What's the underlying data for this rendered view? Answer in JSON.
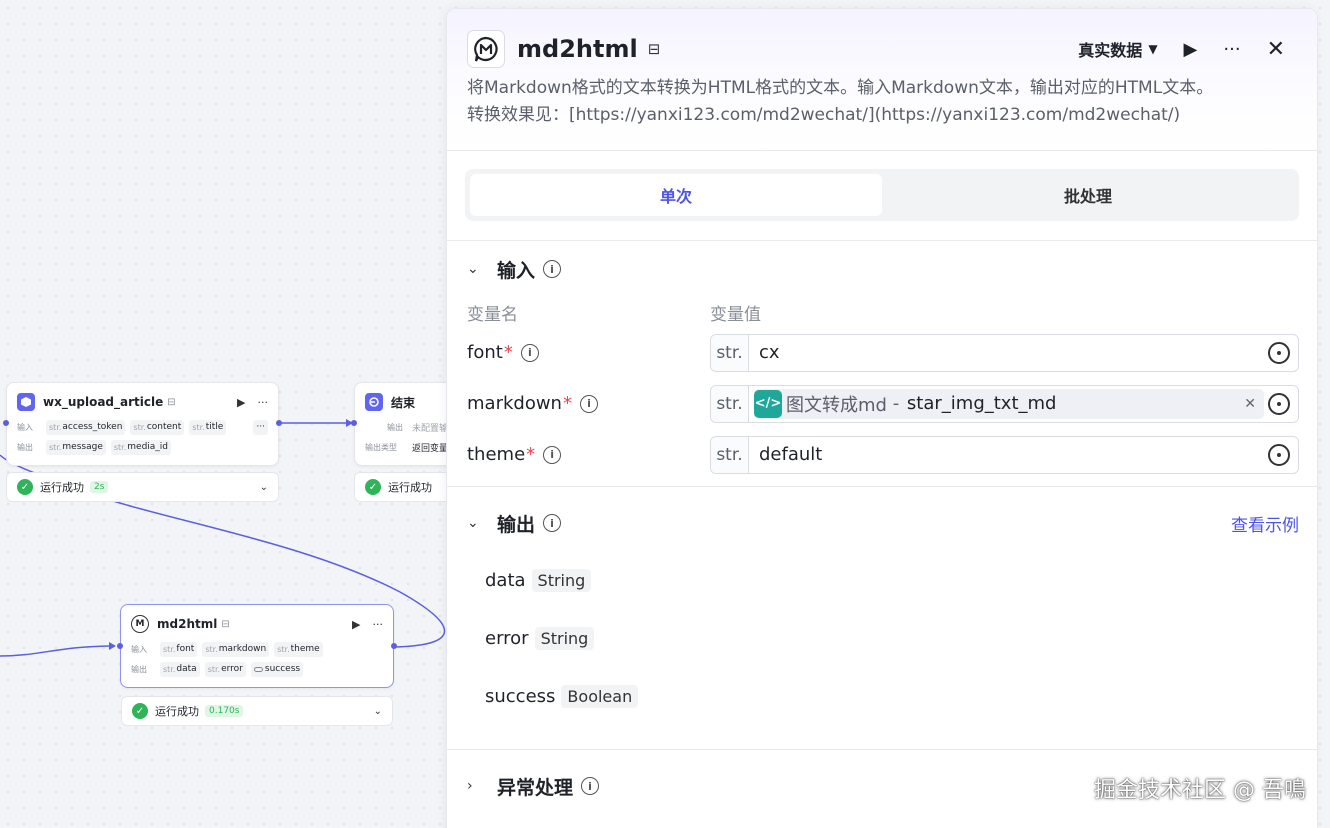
{
  "canvas": {
    "node_upload": {
      "title": "wx_upload_article",
      "input_label": "输入",
      "output_label": "输出",
      "inputs": [
        {
          "type": "str.",
          "name": "access_token"
        },
        {
          "type": "str.",
          "name": "content"
        },
        {
          "type": "str.",
          "name": "title"
        }
      ],
      "more_inputs": "···",
      "outputs": [
        {
          "type": "str.",
          "name": "message"
        },
        {
          "type": "str.",
          "name": "media_id"
        }
      ],
      "status": "运行成功",
      "duration": "2s"
    },
    "node_end": {
      "title": "结束",
      "row1_label": "输出",
      "row1_value": "未配置输",
      "row2_label": "输出类型",
      "row2_value": "返回变量",
      "status": "运行成功"
    },
    "node_md2html": {
      "title": "md2html",
      "input_label": "输入",
      "output_label": "输出",
      "inputs": [
        {
          "type": "str.",
          "name": "font"
        },
        {
          "type": "str.",
          "name": "markdown"
        },
        {
          "type": "str.",
          "name": "theme"
        }
      ],
      "outputs": [
        {
          "type": "str.",
          "name": "data"
        },
        {
          "type": "str.",
          "name": "error"
        },
        {
          "type": "",
          "name": "success"
        }
      ],
      "status": "运行成功",
      "duration": "0.170s"
    }
  },
  "panel": {
    "title": "md2html",
    "dataset_selector": "真实数据",
    "description_line1": "将Markdown格式的文本转换为HTML格式的文本。输入Markdown文本，输出对应的HTML文本。",
    "description_line2": "转换效果见：[https://yanxi123.com/md2wechat/](https://yanxi123.com/md2wechat/)",
    "tabs": [
      {
        "label": "单次",
        "active": true
      },
      {
        "label": "批处理",
        "active": false
      }
    ],
    "input_section": {
      "title": "输入",
      "col_name": "变量名",
      "col_value": "变量值",
      "rows": [
        {
          "name": "font",
          "type": "str.",
          "value": "cx"
        },
        {
          "name": "markdown",
          "type": "str.",
          "ref_source": "图文转成md",
          "ref_sep": " - ",
          "ref_var": "star_img_txt_md"
        },
        {
          "name": "theme",
          "type": "str.",
          "value": "default"
        }
      ]
    },
    "output_section": {
      "title": "输出",
      "link": "查看示例",
      "rows": [
        {
          "name": "data",
          "type": "String"
        },
        {
          "name": "error",
          "type": "String"
        },
        {
          "name": "success",
          "type": "Boolean"
        }
      ]
    },
    "exception_section": {
      "title": "异常处理"
    }
  },
  "watermark": "掘金技术社区 @ 吾鳴",
  "colors": {
    "accent": "#4d53e8",
    "success": "#2fb45a",
    "required": "#e5484d",
    "ref_icon": "#1fa89a",
    "edge": "#5b5fe0"
  }
}
